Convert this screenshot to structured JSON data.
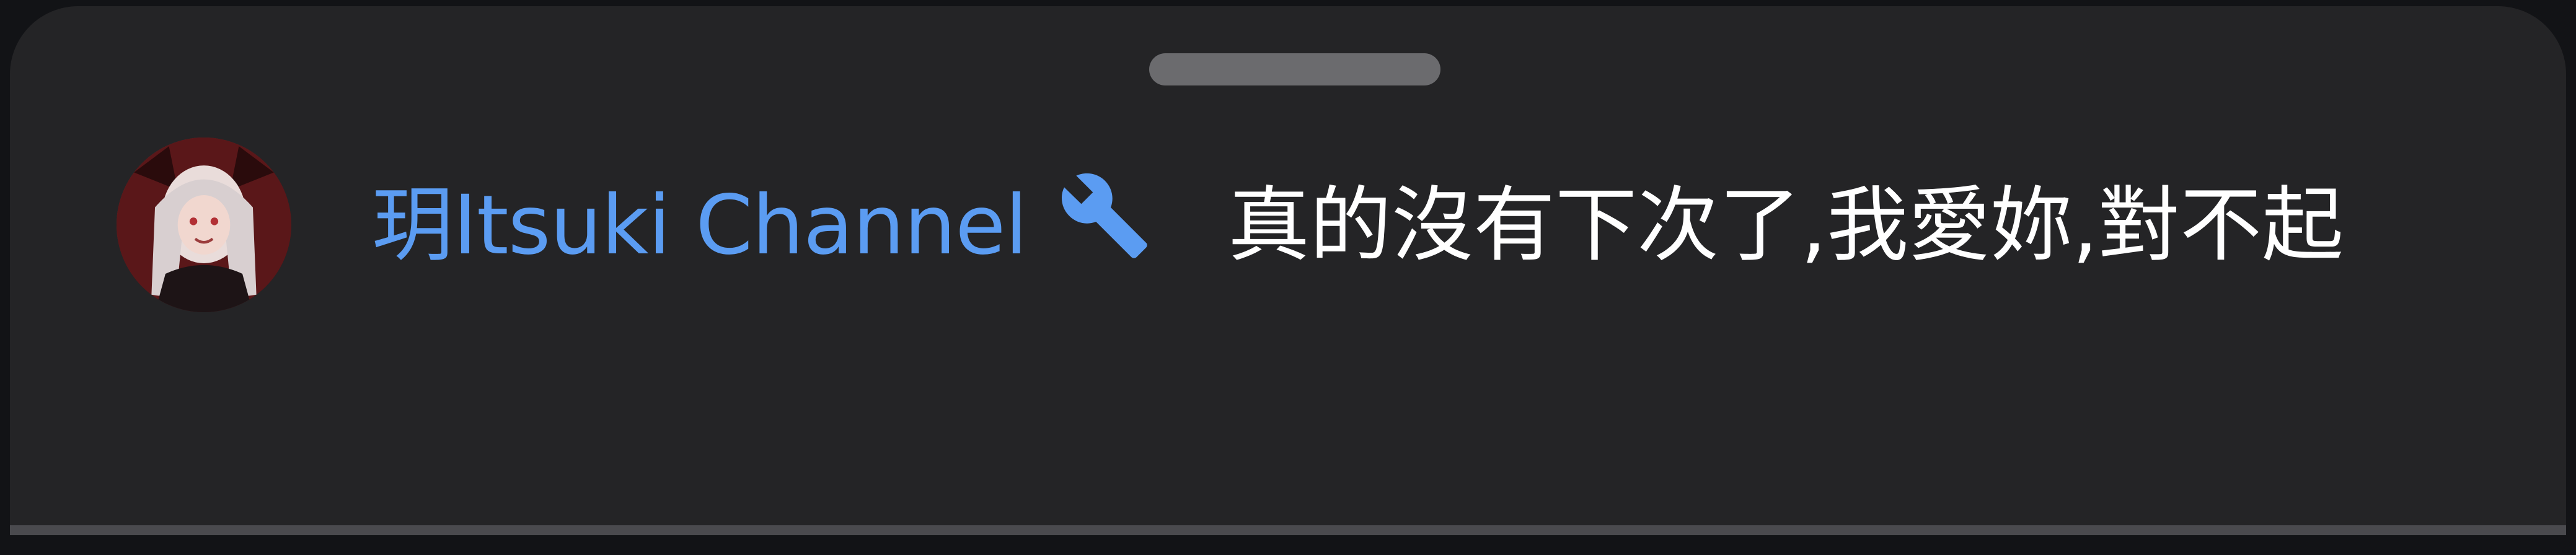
{
  "sheet": {
    "background": "#242426"
  },
  "comment": {
    "author": "玥Itsuki Channel",
    "author_color": "#5b9cf2",
    "badge_icon": "wrench-icon",
    "message": "真的沒有下次了,我愛妳,對不起"
  }
}
